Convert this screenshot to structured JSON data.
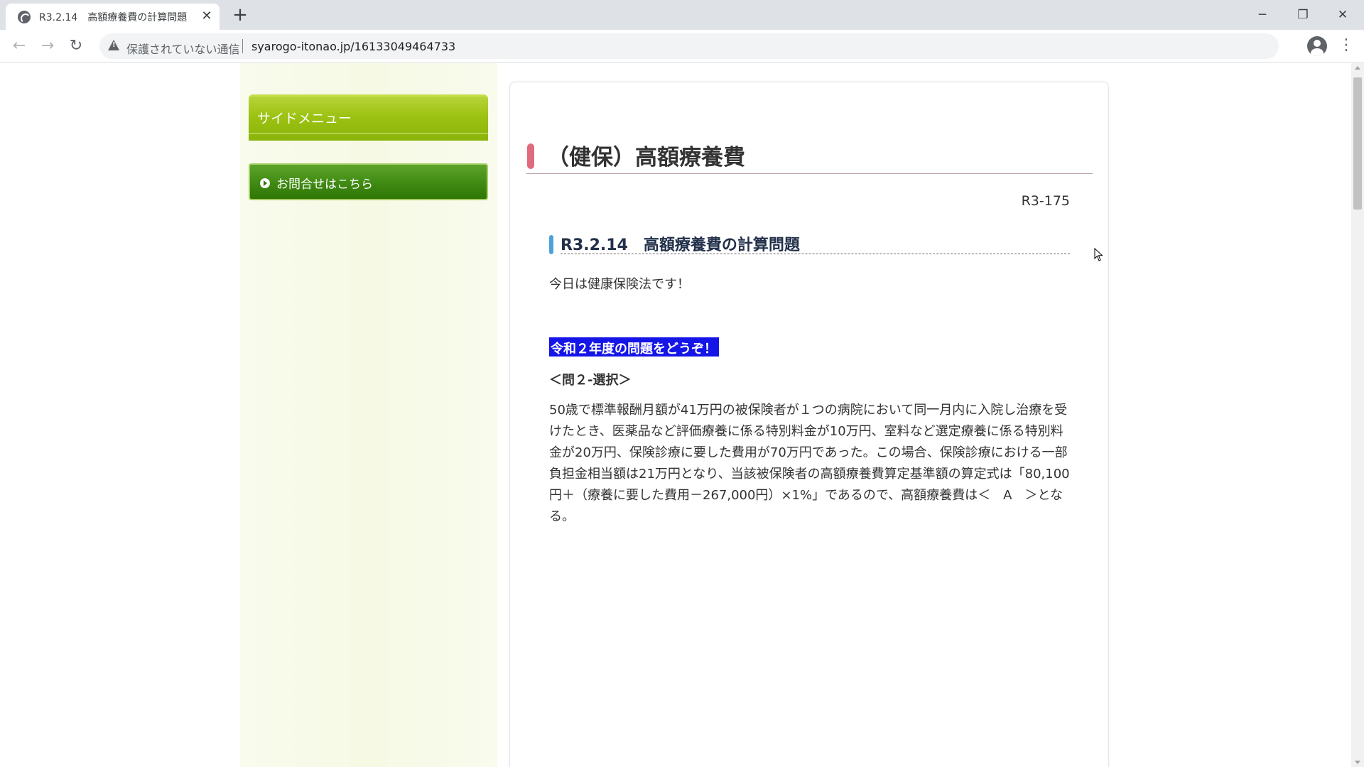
{
  "browser": {
    "tab_title": "R3.2.14　高額療養費の計算問題",
    "new_tab": "+",
    "close_tab": "✕",
    "window_controls": {
      "minimize": "─",
      "restore": "❐",
      "close": "✕"
    },
    "nav": {
      "back": "←",
      "forward": "→",
      "reload": "↻"
    },
    "security_label": "保護されていない通信",
    "url": "syarogo-itonao.jp/16133049464733",
    "bookmark_star": "☆",
    "menu": "⋮",
    "icons": [
      "globe-icon",
      "warning-icon",
      "star-icon",
      "account-icon",
      "kebab-menu-icon"
    ]
  },
  "sidebar": {
    "header": "サイドメニュー",
    "contact_button": "お問合せはこちら",
    "accent_color": "#9cc212",
    "button_color": "#3f8a13"
  },
  "main": {
    "category_title": "（健保）高額療養費",
    "post_id": "R3-175",
    "post_title": "R3.2.14　高額療養費の計算問題",
    "intro": "今日は健康保険法です！",
    "highlight": "令和２年度の問題をどうぞ！",
    "question_label": "＜問２-選択＞",
    "question_text": "50歳で標準報酬月額が41万円の被保険者が１つの病院において同一月内に入院し治療を受けたとき、医薬品など評価療養に係る特別料金が10万円、室料など選定療養に係る特別料金が20万円、保険診療に要した費用が70万円であった。この場合、保険診療における一部負担金相当額は21万円となり、当該被保険者の高額療養費算定基準額の算定式は「80,100円＋（療養に要した費用－267,000円）×1%」であるので、高額療養費は＜　A　＞となる。",
    "category_accent": "#e06b7c",
    "post_accent": "#4da2d9",
    "highlight_color": "#1515e8"
  }
}
